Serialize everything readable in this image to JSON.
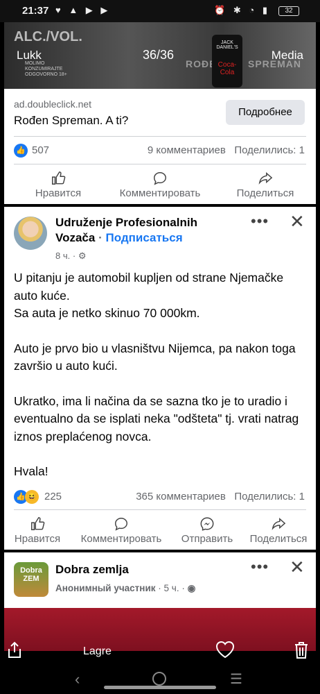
{
  "status_bar": {
    "time": "21:37",
    "battery": "32"
  },
  "viewer": {
    "left_label": "Lukk",
    "counter": "36/36",
    "right_label": "Media"
  },
  "ad_media": {
    "alc_text": "ALC./VOL.",
    "fine_print": "MOLIMO KONZUMIRAJTE ODGOVORNO 18+",
    "can_brand": "JACK DANIEL'S",
    "can_sub": "Coca-Cola",
    "watermark_left": "ROĐEN",
    "watermark_right": "SPREMAN"
  },
  "ad_card": {
    "domain": "ad.doubleclick.net",
    "headline": "Rođen Spreman. A ti?",
    "cta": "Подробнее",
    "reactions_count": "507",
    "comments": "9 комментариев",
    "shares": "Поделились: 1",
    "actions": [
      "Нравится",
      "Комментировать",
      "Поделиться"
    ]
  },
  "post": {
    "author_line1": "Udruženje Profesionalnih",
    "author_line2": "Vozača",
    "separator": "·",
    "follow": "Подписаться",
    "time": "8 ч.",
    "separator2": "·",
    "paragraphs": [
      "U pitanju je automobil kupljen od strane Njemačke auto kuće.\nSa auta je netko skinuo 70 000km.",
      "Auto je prvo bio u vlasništvu Nijemca, pa nakon toga završio u auto kući.",
      "Ukratko, ima li načina da se sazna tko je to uradio i eventualno da se isplati neka \"odšteta\" tj. vrati natrag iznos preplaćenog novca.",
      "Hvala!"
    ],
    "reactions_count": "225",
    "comments": "365 комментариев",
    "shares": "Поделились: 1",
    "actions": [
      "Нравится",
      "Комментировать",
      "Отправить",
      "Поделиться"
    ]
  },
  "group_post": {
    "group_name": "Dobra zemlja",
    "avatar_text": "Dobra ZEM",
    "member": "Анонимный участник",
    "separator": "·",
    "time": "5 ч.",
    "separator2": "·"
  },
  "bottom_bar": {
    "label": "Lagre"
  },
  "icons": [
    "share-icon",
    "heart-icon",
    "trash-icon",
    "like-icon",
    "comment-icon",
    "share-arrow-icon",
    "messenger-icon",
    "more-icon",
    "close-icon",
    "globe-icon",
    "gear-icon"
  ],
  "colors": {
    "accent": "#1877f2",
    "ad_bg": "#a3192a",
    "text_secondary": "#65676b"
  }
}
